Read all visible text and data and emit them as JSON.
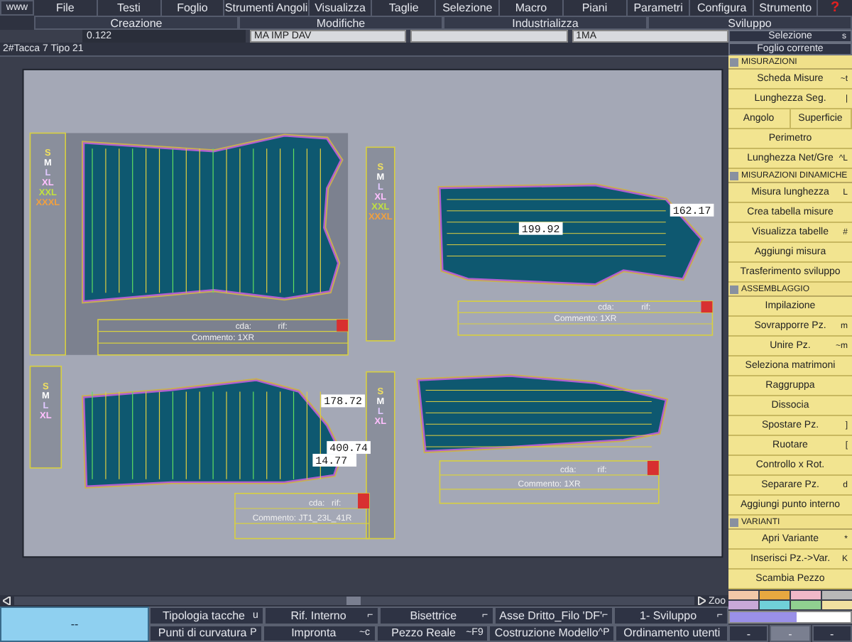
{
  "menu": {
    "logo": "www",
    "items": [
      "File",
      "Testi",
      "Foglio",
      "Strumenti Angoli",
      "Visualizza",
      "Taglie",
      "Selezione",
      "Macro",
      "Piani",
      "Parametri",
      "Configura",
      "Strumento"
    ],
    "help": "?"
  },
  "sections": [
    "Creazione",
    "Modifiche",
    "Industrializza",
    "Sviluppo"
  ],
  "fields": [
    {
      "value": "0.122",
      "kind": "plain"
    },
    {
      "value": "MA IMP DAV",
      "kind": "input"
    },
    {
      "kind": "input"
    },
    {
      "value": "1MA",
      "kind": "input"
    }
  ],
  "status": "2#Tacca 7 Tipo 21",
  "canvas": {
    "label_columns": [
      {
        "sizes": [
          {
            "label": "S",
            "color": "#f0e060"
          },
          {
            "label": "M",
            "color": "#ffffff"
          },
          {
            "label": "L",
            "color": "#e0c8ff"
          },
          {
            "label": "XL",
            "color": "#ffc0ff"
          },
          {
            "label": "XXL",
            "color": "#c0e040"
          },
          {
            "label": "XXXL",
            "color": "#f0a040"
          }
        ]
      },
      {
        "sizes": [
          {
            "label": "S",
            "color": "#f0e060"
          },
          {
            "label": "M",
            "color": "#ffffff"
          },
          {
            "label": "L",
            "color": "#e0c8ff"
          },
          {
            "label": "XL",
            "color": "#ffc0ff"
          },
          {
            "label": "XXL",
            "color": "#c0e040"
          },
          {
            "label": "XXXL",
            "color": "#f0a040"
          }
        ]
      },
      {
        "sizes": [
          {
            "label": "S",
            "color": "#f0e060"
          },
          {
            "label": "M",
            "color": "#ffffff"
          },
          {
            "label": "L",
            "color": "#e0c8ff"
          },
          {
            "label": "XL",
            "color": "#ffc0ff"
          }
        ]
      },
      {
        "sizes": [
          {
            "label": "S",
            "color": "#f0e060"
          },
          {
            "label": "M",
            "color": "#ffffff"
          },
          {
            "label": "L",
            "color": "#e0c8ff"
          },
          {
            "label": "XL",
            "color": "#ffc0ff"
          }
        ]
      }
    ],
    "pieces": [
      {
        "cda": "cda:",
        "rif": "rif:",
        "comment": "Commento: 1XR"
      },
      {
        "cda": "cda:",
        "rif": "rif:",
        "comment": "Commento: 1XR",
        "measurements": [
          "199.92",
          "162.17"
        ]
      },
      {
        "cda": "cda:",
        "rif": "rif:",
        "comment": "Commento: JT1_23L_41R",
        "measurements": [
          "178.72",
          "400.74",
          "14.77"
        ]
      },
      {
        "cda": "cda:",
        "rif": "rif:",
        "comment": "Commento: 1XR"
      }
    ]
  },
  "scrollbar": {
    "zoom": "Zoo"
  },
  "toolbar": {
    "main": "--",
    "rows": [
      [
        {
          "label": "Tipologia tacche",
          "key": "u"
        },
        {
          "label": "Rif. Interno",
          "key": "⌐"
        },
        {
          "label": "Bisettrice",
          "key": "⌐"
        },
        {
          "label": "Asse Dritto_Filo 'DF'",
          "key": "⌐"
        },
        {
          "label": "1- Sviluppo",
          "key": "⌐"
        }
      ],
      [
        {
          "label": "Punti di curvatura",
          "key": "P"
        },
        {
          "label": "Impronta",
          "key": "~c"
        },
        {
          "label": "Pezzo Reale",
          "key": "~F9"
        },
        {
          "label": "Costruzione Modello",
          "key": "^P"
        },
        {
          "label": "Ordinamento utenti"
        }
      ]
    ]
  },
  "panel": {
    "selection": "Selezione",
    "selection_key": "s",
    "sheet": "Foglio corrente",
    "items": [
      {
        "kind": "header",
        "label": "MISURAZIONI"
      },
      {
        "kind": "button",
        "label": "Scheda Misure",
        "key": "~t"
      },
      {
        "kind": "button",
        "label": "Lunghezza Seg.",
        "key": "|"
      },
      {
        "kind": "pair",
        "labels": [
          "Angolo",
          "Superficie"
        ]
      },
      {
        "kind": "button",
        "label": "Perimetro"
      },
      {
        "kind": "button",
        "label": "Lunghezza Net/Gre",
        "key": "^L"
      },
      {
        "kind": "header",
        "label": "MISURAZIONI DINAMICHE"
      },
      {
        "kind": "button",
        "label": "Misura lunghezza",
        "key": "L"
      },
      {
        "kind": "button",
        "label": "Crea tabella misure"
      },
      {
        "kind": "button",
        "label": "Visualizza tabelle",
        "key": "#"
      },
      {
        "kind": "button",
        "label": "Aggiungi misura"
      },
      {
        "kind": "button",
        "label": "Trasferimento sviluppo"
      },
      {
        "kind": "header",
        "label": "ASSEMBLAGGIO"
      },
      {
        "kind": "button",
        "label": "Impilazione"
      },
      {
        "kind": "button",
        "label": "Sovrapporre Pz.",
        "key": "m"
      },
      {
        "kind": "button",
        "label": "Unire Pz.",
        "key": "~m"
      },
      {
        "kind": "button",
        "label": "Seleziona matrimoni"
      },
      {
        "kind": "button",
        "label": "Raggruppa"
      },
      {
        "kind": "button",
        "label": "Dissocia"
      },
      {
        "kind": "button",
        "label": "Spostare Pz.",
        "key": "]"
      },
      {
        "kind": "button",
        "label": "Ruotare",
        "key": "["
      },
      {
        "kind": "button",
        "label": "Controllo x Rot."
      },
      {
        "kind": "button",
        "label": "Separare Pz.",
        "key": "d"
      },
      {
        "kind": "button",
        "label": "Aggiungi punto interno"
      },
      {
        "kind": "header",
        "label": "VARIANTI"
      },
      {
        "kind": "button",
        "label": "Apri Variante",
        "key": "*"
      },
      {
        "kind": "button",
        "label": "Inserisci Pz.->Var.",
        "key": "K"
      },
      {
        "kind": "button",
        "label": "Scambia Pezzo"
      }
    ],
    "nav": [
      "-",
      "-",
      "-"
    ]
  }
}
